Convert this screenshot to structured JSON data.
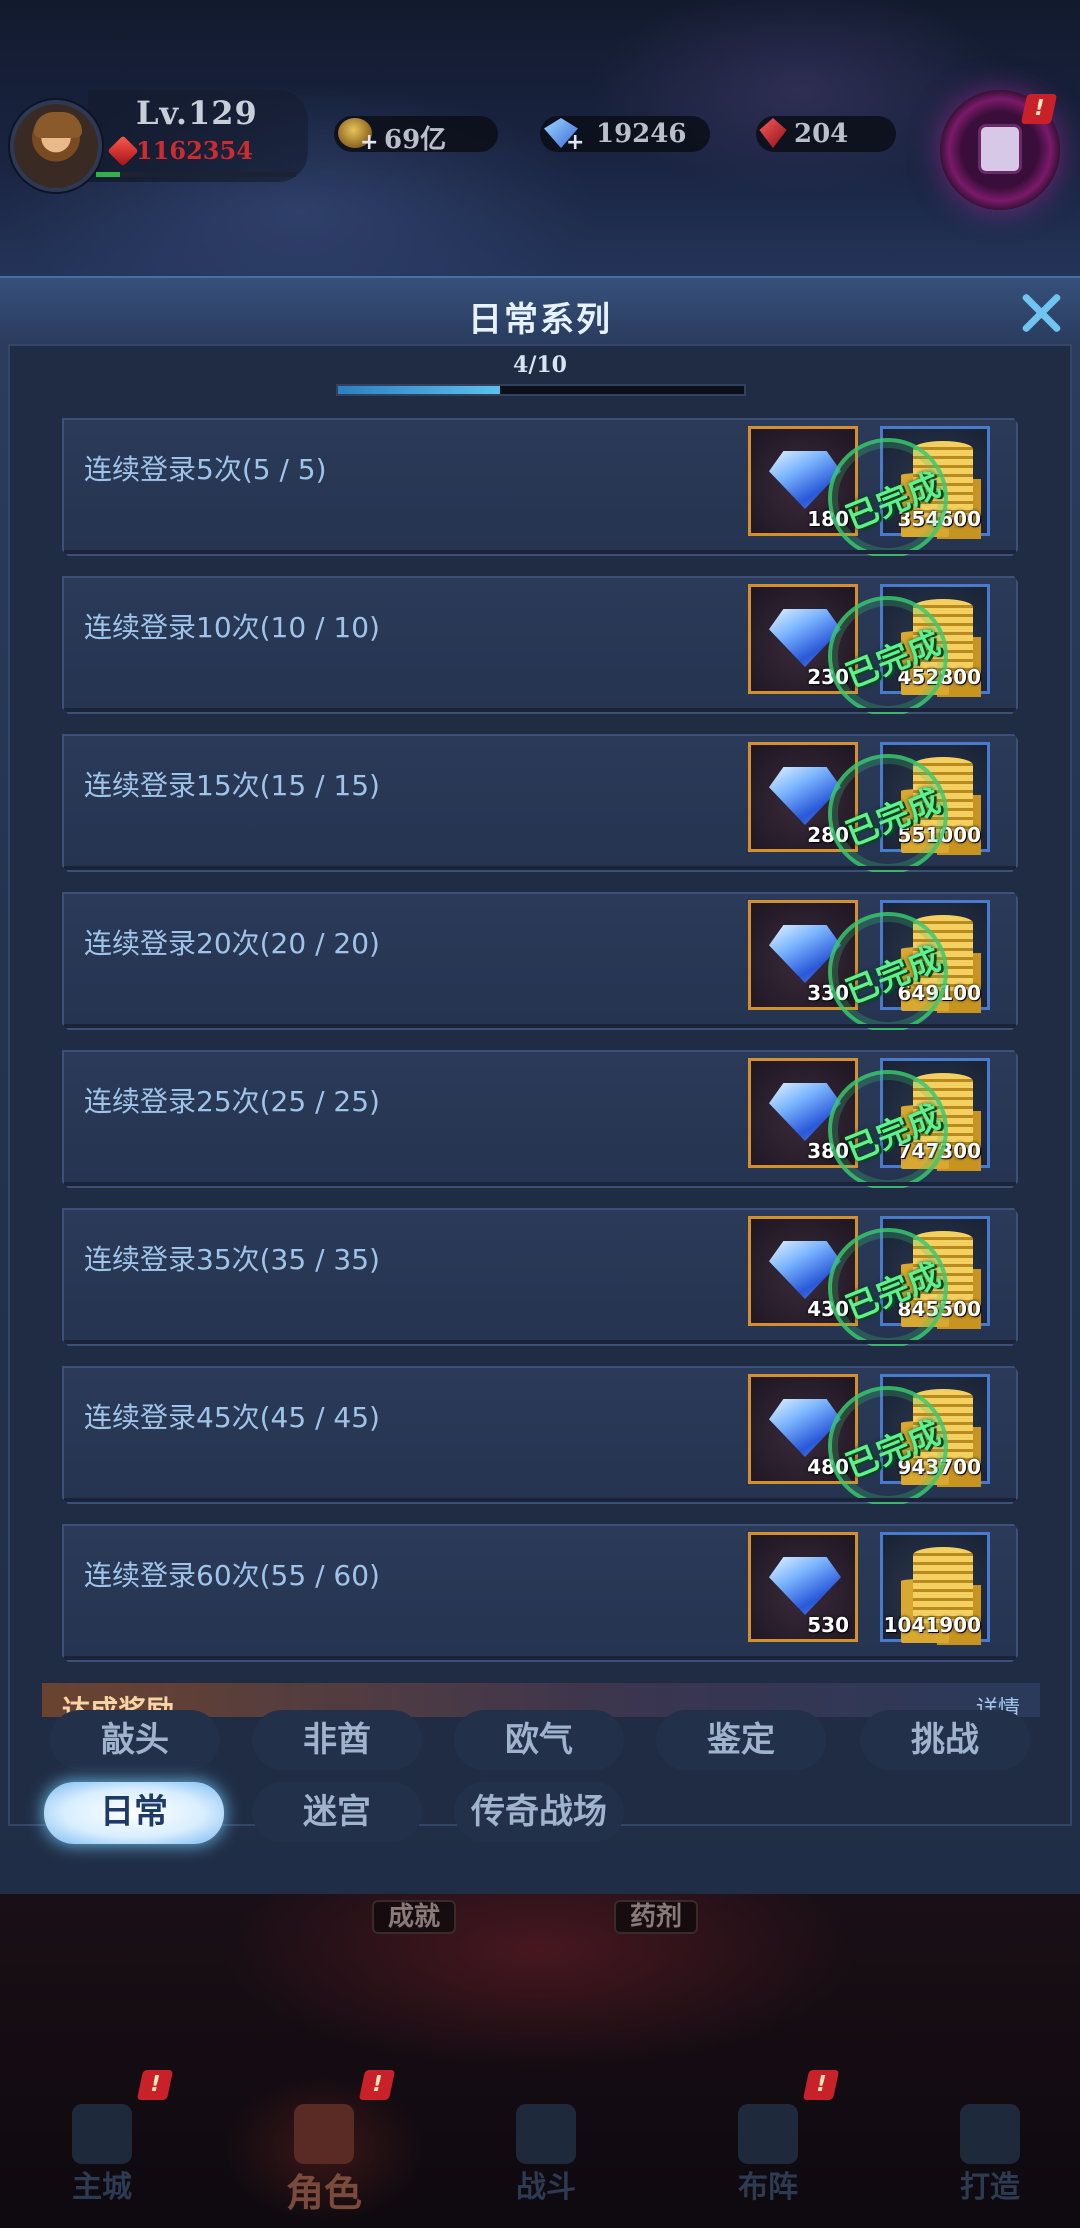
{
  "player": {
    "level": "Lv.129",
    "power": "1162354",
    "exp_fraction": 0.12
  },
  "currencies": [
    {
      "name": "gold",
      "value": "69亿",
      "icon": "gold-ingot-icon"
    },
    {
      "name": "diamond",
      "value": "19246",
      "icon": "diamond-icon"
    },
    {
      "name": "ruby",
      "value": "204",
      "icon": "ruby-icon"
    }
  ],
  "quest_alert": "!",
  "panel": {
    "title": "日常系列",
    "progress_text": "4/10",
    "progress_fraction": 0.4
  },
  "tasks": [
    {
      "name": "连续登录5次(5 / 5)",
      "gem_qty": "180",
      "gold_qty": "354600",
      "completed": true
    },
    {
      "name": "连续登录10次(10 / 10)",
      "gem_qty": "230",
      "gold_qty": "452800",
      "completed": true
    },
    {
      "name": "连续登录15次(15 / 15)",
      "gem_qty": "280",
      "gold_qty": "551000",
      "completed": true
    },
    {
      "name": "连续登录20次(20 / 20)",
      "gem_qty": "330",
      "gold_qty": "649100",
      "completed": true
    },
    {
      "name": "连续登录25次(25 / 25)",
      "gem_qty": "380",
      "gold_qty": "747300",
      "completed": true
    },
    {
      "name": "连续登录35次(35 / 35)",
      "gem_qty": "430",
      "gold_qty": "845500",
      "completed": true
    },
    {
      "name": "连续登录45次(45 / 45)",
      "gem_qty": "480",
      "gold_qty": "943700",
      "completed": true
    },
    {
      "name": "连续登录60次(55 / 60)",
      "gem_qty": "530",
      "gold_qty": "1041900",
      "completed": false
    }
  ],
  "completed_stamp": "已完成",
  "achievement_strip": {
    "label": "达成奖励",
    "detail": "详情"
  },
  "category_tabs": [
    {
      "label": "敲头",
      "active": false
    },
    {
      "label": "非酋",
      "active": false
    },
    {
      "label": "欧气",
      "active": false
    },
    {
      "label": "鉴定",
      "active": false
    },
    {
      "label": "挑战",
      "active": false
    },
    {
      "label": "日常",
      "active": true
    },
    {
      "label": "迷宫",
      "active": false
    },
    {
      "label": "传奇战场",
      "active": false
    }
  ],
  "feature_labels": [
    "成就",
    "药剂"
  ],
  "bottom_nav": [
    {
      "label": "主城",
      "icon": "castle-icon",
      "alert": "!",
      "active": false
    },
    {
      "label": "角色",
      "icon": "helmet-icon",
      "alert": "!",
      "active": true
    },
    {
      "label": "战斗",
      "icon": "crossed-swords-icon",
      "alert": "",
      "active": false
    },
    {
      "label": "布阵",
      "icon": "formation-icon",
      "alert": "!",
      "active": false
    },
    {
      "label": "打造",
      "icon": "anvil-icon",
      "alert": "",
      "active": false
    }
  ]
}
